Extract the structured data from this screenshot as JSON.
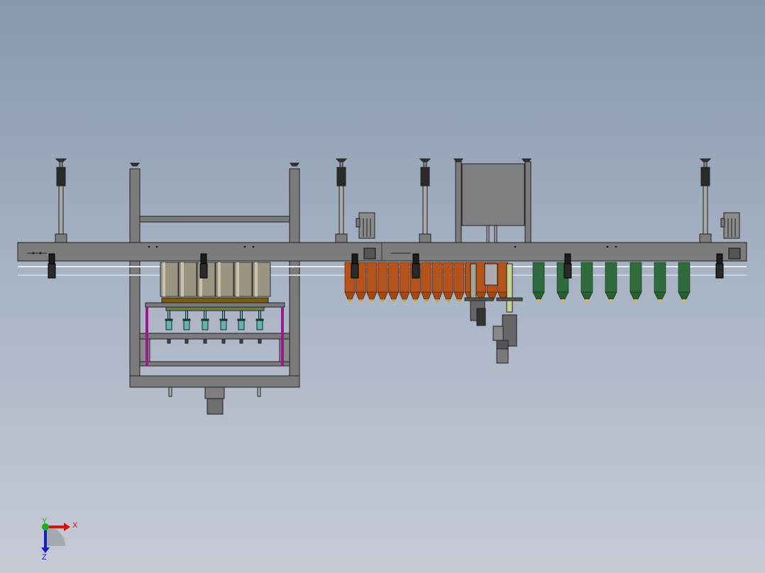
{
  "viewport": {
    "triad": {
      "x_label": "X",
      "y_label": "Y",
      "z_label": "Z"
    },
    "colors": {
      "frame": "#7b7b7b",
      "beige_bottle": "#9a9482",
      "orange_bottle": "#b4531c",
      "green_bottle": "#2f6b3c",
      "teal_nozzle": "#5fb8a4",
      "magenta_rod": "#9b1a8f",
      "x_axis": "#d81010",
      "y_axis": "#1fae1f",
      "z_axis": "#1020c0"
    }
  }
}
